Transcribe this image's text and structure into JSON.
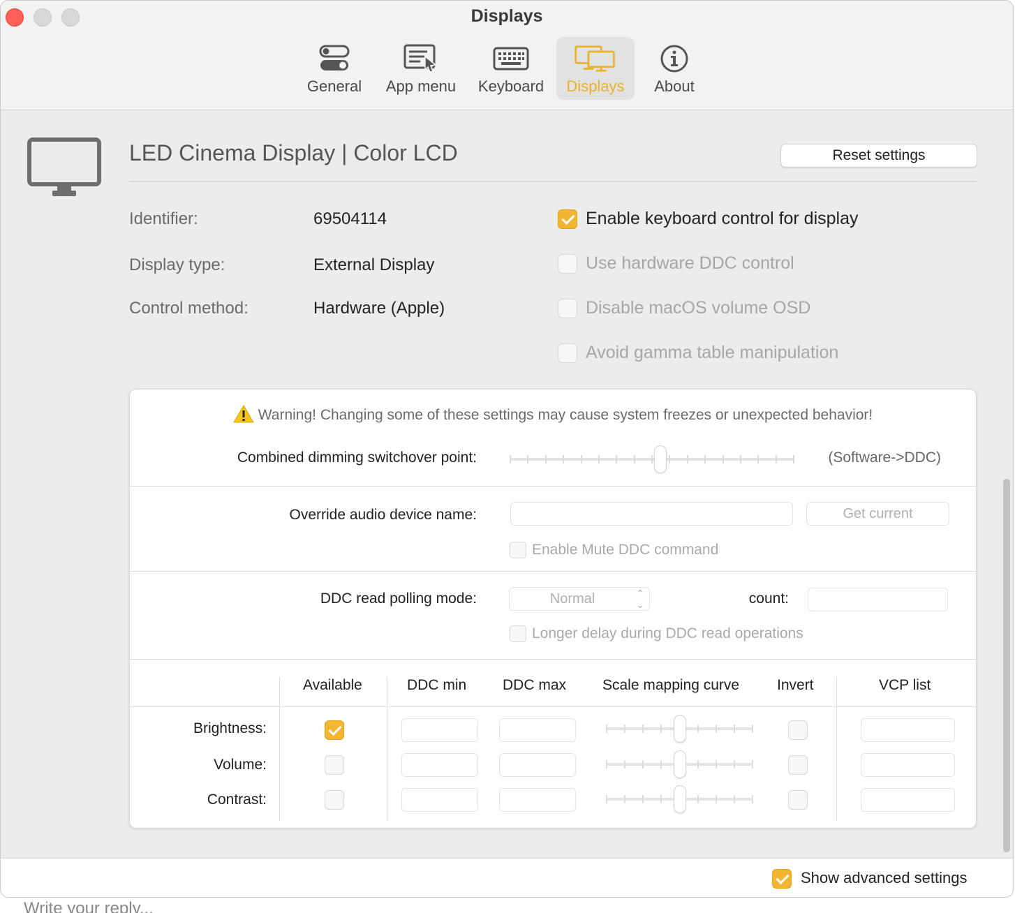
{
  "window": {
    "title": "Displays"
  },
  "tabs": [
    {
      "id": "general",
      "label": "General",
      "icon": "toggles-icon"
    },
    {
      "id": "app-menu",
      "label": "App menu",
      "icon": "menu-cursor-icon"
    },
    {
      "id": "keyboard",
      "label": "Keyboard",
      "icon": "keyboard-icon"
    },
    {
      "id": "displays",
      "label": "Displays",
      "icon": "displays-icon",
      "active": true
    },
    {
      "id": "about",
      "label": "About",
      "icon": "info-icon"
    }
  ],
  "accent_color": "#f2b632",
  "display": {
    "name": "LED Cinema Display | Color LCD",
    "reset_label": "Reset settings",
    "info": [
      {
        "label": "Identifier:",
        "value": "69504114"
      },
      {
        "label": "Display type:",
        "value": "External Display"
      },
      {
        "label": "Control method:",
        "value": "Hardware (Apple)"
      }
    ],
    "options": [
      {
        "label": "Enable keyboard control for display",
        "checked": true,
        "enabled": true
      },
      {
        "label": "Use hardware DDC control",
        "checked": false,
        "enabled": false
      },
      {
        "label": "Disable macOS volume OSD",
        "checked": false,
        "enabled": false
      },
      {
        "label": "Avoid gamma table manipulation",
        "checked": false,
        "enabled": false
      }
    ]
  },
  "advanced": {
    "warning_icon": "warning-triangle-icon",
    "warning": "Warning! Changing some of these settings may cause system freezes or unexpected behavior!",
    "switchover_label": "Combined dimming switchover point:",
    "switchover_hint": "(Software->DDC)",
    "switchover_value_fraction": 0.53,
    "audio_label": "Override audio device name:",
    "audio_value": "",
    "get_current_label": "Get current",
    "mute_label": "Enable Mute DDC command",
    "polling_label": "DDC read polling mode:",
    "polling_value": "Normal",
    "count_label": "count:",
    "count_value": "",
    "longer_delay_label": "Longer delay during DDC read operations",
    "table": {
      "headers": [
        "Available",
        "DDC min",
        "DDC max",
        "Scale mapping curve",
        "Invert",
        "VCP list"
      ],
      "rows": [
        {
          "label": "Brightness:",
          "available": true,
          "curve_fraction": 0.5
        },
        {
          "label": "Volume:",
          "available": false,
          "curve_fraction": 0.5
        },
        {
          "label": "Contrast:",
          "available": false,
          "curve_fraction": 0.5
        }
      ]
    }
  },
  "footer": {
    "show_advanced_label": "Show advanced settings",
    "show_advanced_checked": true
  },
  "reply_placeholder": "Write your reply..."
}
